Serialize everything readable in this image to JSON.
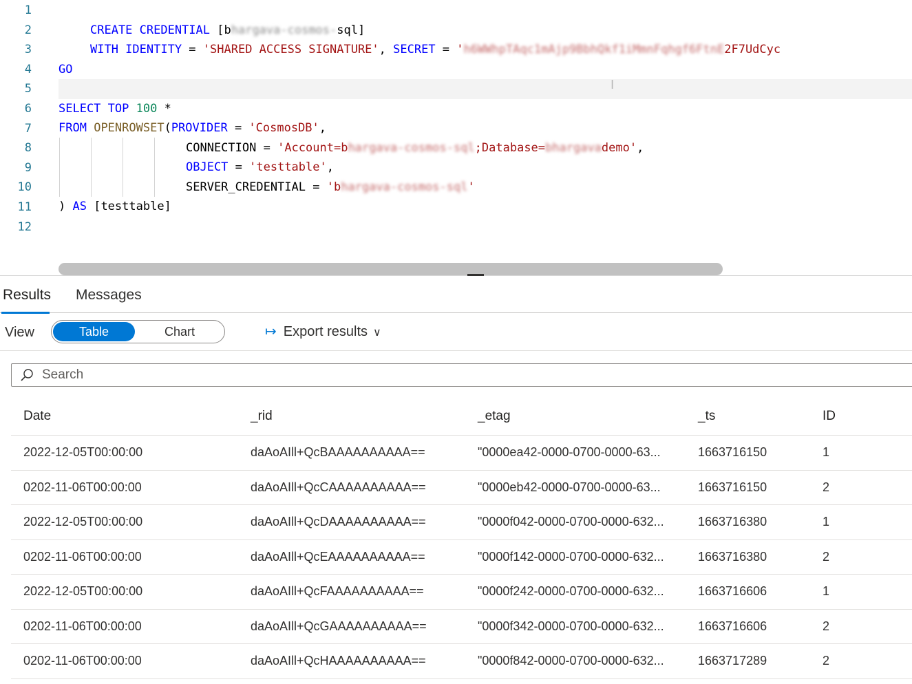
{
  "editor": {
    "line_numbers": [
      "1",
      "2",
      "3",
      "4",
      "5",
      "6",
      "7",
      "8",
      "9",
      "10",
      "11",
      "12"
    ],
    "line2": {
      "kw1": "CREATE CREDENTIAL",
      "open": " [",
      "first": "b",
      "redacted": "hargava-cosmos-",
      "rest": "sql]"
    },
    "line3": {
      "kw1": "WITH IDENTITY",
      "eq": " = ",
      "str1": "'SHARED ACCESS SIGNATURE'",
      "comma": ", ",
      "kw2": "SECRET",
      "eq2": " = ",
      "str_open": "'",
      "redacted": "h6WWhpTAqc1mAjp9BbhQkf1iMmnFqhgf6FtnE",
      "str_tail": "2F7UdCyc"
    },
    "line4": "GO",
    "line6": {
      "kw1": "SELECT TOP",
      "space": " ",
      "num": "100",
      "rest": " *"
    },
    "line7": {
      "kw1": "FROM",
      "space": " ",
      "fn": "OPENROWSET",
      "paren": "(",
      "kw2": "PROVIDER",
      "eq": " = ",
      "str": "'CosmosDB'",
      "comma": ","
    },
    "line8": {
      "key": "CONNECTION",
      "eq": " = ",
      "str_a": "'Account=b",
      "redacted": "hargava-cosmos-sql",
      "str_b": ";Database=",
      "redacted2": "bhargava",
      "str_c": "demo'",
      "comma": ","
    },
    "line9": {
      "kw": "OBJECT",
      "eq": " = ",
      "str": "'testtable'",
      "comma": ","
    },
    "line10": {
      "key": "SERVER_CREDENTIAL",
      "eq": " = ",
      "str_a": "'b",
      "redacted": "hargava-cosmos-sql",
      "str_b": "'"
    },
    "line11": {
      "paren": ") ",
      "kw": "AS",
      "rest": " [testtable]"
    }
  },
  "results": {
    "tabs": [
      "Results",
      "Messages"
    ],
    "active_tab": "Results",
    "view_label": "View",
    "toggle": {
      "on": "Table",
      "off": "Chart",
      "selected": "Table"
    },
    "export_label": "Export results",
    "search_placeholder": "Search",
    "columns": [
      "Date",
      "_rid",
      "_etag",
      "_ts",
      "ID"
    ],
    "rows": [
      [
        "2022-12-05T00:00:00",
        "daAoAIll+QcBAAAAAAAAAA==",
        "\"0000ea42-0000-0700-0000-63...",
        "1663716150",
        "1"
      ],
      [
        "0202-11-06T00:00:00",
        "daAoAIll+QcCAAAAAAAAAA==",
        "\"0000eb42-0000-0700-0000-63...",
        "1663716150",
        "2"
      ],
      [
        "2022-12-05T00:00:00",
        "daAoAIll+QcDAAAAAAAAAA==",
        "\"0000f042-0000-0700-0000-632...",
        "1663716380",
        "1"
      ],
      [
        "0202-11-06T00:00:00",
        "daAoAIll+QcEAAAAAAAAAA==",
        "\"0000f142-0000-0700-0000-632...",
        "1663716380",
        "2"
      ],
      [
        "2022-12-05T00:00:00",
        "daAoAIll+QcFAAAAAAAAAA==",
        "\"0000f242-0000-0700-0000-632...",
        "1663716606",
        "1"
      ],
      [
        "0202-11-06T00:00:00",
        "daAoAIll+QcGAAAAAAAAAA==",
        "\"0000f342-0000-0700-0000-632...",
        "1663716606",
        "2"
      ],
      [
        "0202-11-06T00:00:00",
        "daAoAIll+QcHAAAAAAAAAA==",
        "\"0000f842-0000-0700-0000-632...",
        "1663717289",
        "2"
      ]
    ]
  },
  "colors": {
    "accent": "#0078d4",
    "keyword": "#0000ff",
    "string": "#a31515",
    "number": "#098658",
    "line_number": "#237893"
  }
}
